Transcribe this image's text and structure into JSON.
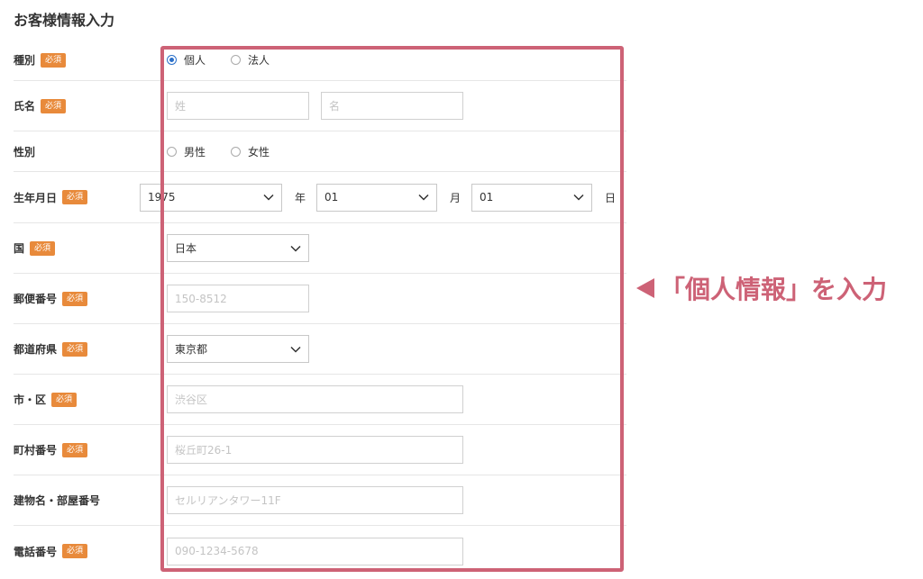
{
  "title": "お客様情報入力",
  "required_badge": "必須",
  "fields": {
    "type": {
      "label": "種別",
      "options": [
        "個人",
        "法人"
      ],
      "selected": "個人"
    },
    "name": {
      "label": "氏名",
      "last_placeholder": "姓",
      "first_placeholder": "名"
    },
    "gender": {
      "label": "性別",
      "options": [
        "男性",
        "女性"
      ]
    },
    "birthdate": {
      "label": "生年月日",
      "year": "1975",
      "year_unit": "年",
      "month": "01",
      "month_unit": "月",
      "day": "01",
      "day_unit": "日"
    },
    "country": {
      "label": "国",
      "value": "日本"
    },
    "postal": {
      "label": "郵便番号",
      "placeholder": "150-8512"
    },
    "prefecture": {
      "label": "都道府県",
      "value": "東京都"
    },
    "city": {
      "label": "市・区",
      "placeholder": "渋谷区"
    },
    "street": {
      "label": "町村番号",
      "placeholder": "桜丘町26-1"
    },
    "building": {
      "label": "建物名・部屋番号",
      "placeholder": "セルリアンタワー11F"
    },
    "phone": {
      "label": "電話番号",
      "placeholder": "090-1234-5678"
    }
  },
  "callout": {
    "text": "「個人情報」を入力"
  },
  "colors": {
    "highlight": "#cd6276",
    "badge": "#e88a3b",
    "radio_checked": "#2b70c9"
  }
}
